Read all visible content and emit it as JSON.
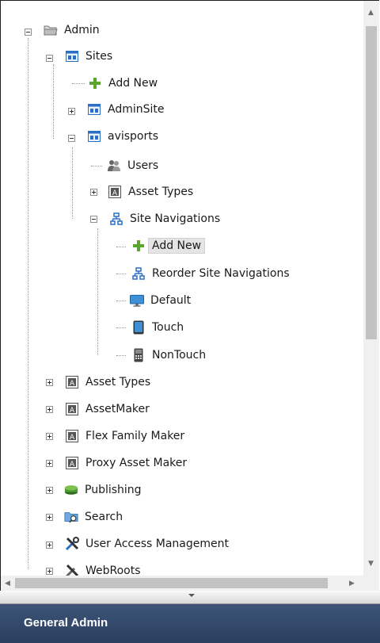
{
  "tree": {
    "admin_label": "Admin",
    "sites_label": "Sites",
    "sites_add_new": "Add New",
    "adminsite_label": "AdminSite",
    "avisports_label": "avisports",
    "users_label": "Users",
    "avisports_asset_types": "Asset Types",
    "site_navigations_label": "Site Navigations",
    "nav_add_new": "Add New",
    "reorder_label": "Reorder Site Navigations",
    "default_label": "Default",
    "touch_label": "Touch",
    "nontouch_label": "NonTouch",
    "asset_types_label": "Asset Types",
    "assetmaker_label": "AssetMaker",
    "flex_family_maker_label": "Flex Family Maker",
    "proxy_asset_maker_label": "Proxy Asset Maker",
    "publishing_label": "Publishing",
    "search_label": "Search",
    "user_access_label": "User Access Management",
    "webroots_label": "WebRoots"
  },
  "footer": {
    "title": "General Admin"
  },
  "colors": {
    "header_bg": "#34496b",
    "header_text": "#ffffff",
    "plus_green": "#5aa52c",
    "site_blue": "#2a6fc4"
  }
}
